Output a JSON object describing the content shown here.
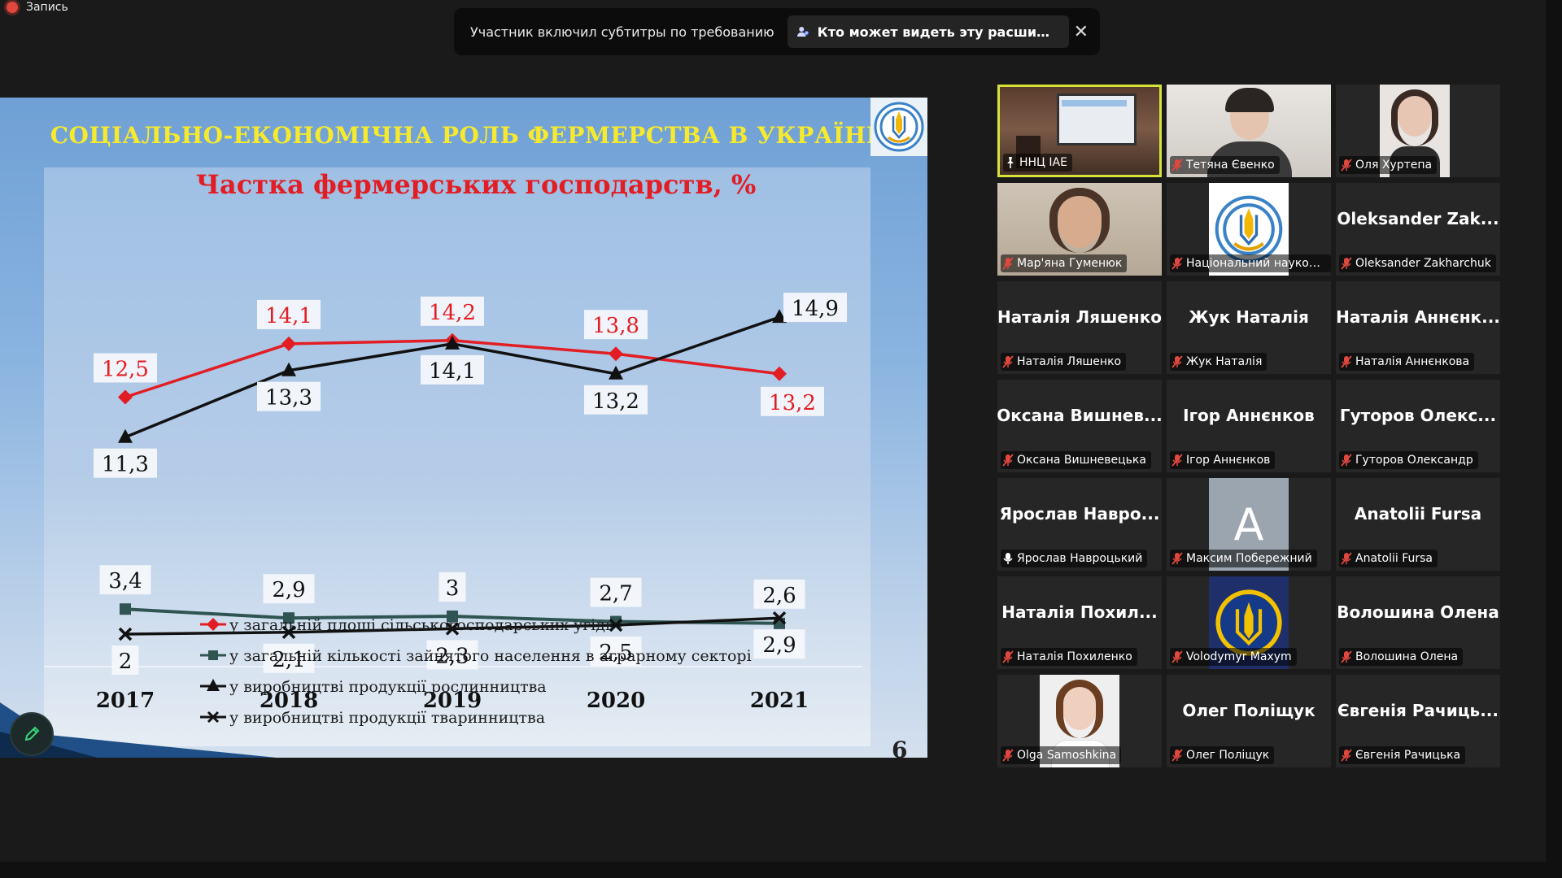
{
  "recording": {
    "label": "Запись"
  },
  "notification": {
    "text": "Участник включил субтитры по требованию",
    "prompt": "Кто может видеть эту расшифровку? За..."
  },
  "slide": {
    "title": "СОЦІАЛЬНО-ЕКОНОМІЧНА РОЛЬ ФЕРМЕРСТВА В УКРАЇНІ",
    "page_number": "6"
  },
  "chart_data": {
    "type": "line",
    "title": "Частка фермерських господарств, %",
    "x": [
      "2017",
      "2018",
      "2019",
      "2020",
      "2021"
    ],
    "series": [
      {
        "name": "у загальній площі сільськогосподарських угідь",
        "marker": "diamond",
        "color": "#e21d24",
        "values": [
          12.5,
          14.1,
          14.2,
          13.8,
          13.2
        ],
        "labels": [
          "12,5",
          "14,1",
          "14,2",
          "13,8",
          "13,2"
        ]
      },
      {
        "name": "у загальній кількості зайнятого населення в аграрному секторі",
        "marker": "square",
        "color": "#2f5452",
        "values": [
          3.4,
          2.9,
          3,
          2.7,
          2.6
        ],
        "labels": [
          "3,4",
          "2,9",
          "3",
          "2,7",
          "2,6"
        ]
      },
      {
        "name": "у виробництві продукції рослинництва",
        "marker": "triangle",
        "color": "#111111",
        "values": [
          11.3,
          13.3,
          14.1,
          13.2,
          14.9
        ],
        "labels": [
          "11,3",
          "13,3",
          "14,1",
          "13,2",
          "14,9"
        ]
      },
      {
        "name": "у виробництві продукції тваринництва",
        "marker": "cross",
        "color": "#111111",
        "values": [
          2,
          2.1,
          2.3,
          2.5,
          2.9
        ],
        "labels": [
          "2",
          "2,1",
          "2,3",
          "2,5",
          "2,9"
        ]
      }
    ],
    "ylim": [
      0,
      16
    ],
    "grid": false,
    "legend": "bottom"
  },
  "participants": [
    {
      "name": "ННЦ ІАЕ",
      "tile_label": "",
      "muted": false,
      "pinned": true,
      "video": "room",
      "active": true
    },
    {
      "name": "Тетяна Євенко",
      "tile_label": "",
      "muted": true,
      "video": "person-light"
    },
    {
      "name": "Оля Хуртепа",
      "tile_label": "",
      "muted": true,
      "video": "person-portrait"
    },
    {
      "name": "Мар'яна Гуменюк",
      "tile_label": "",
      "muted": true,
      "video": "person-warm"
    },
    {
      "name": "Національний науков...",
      "tile_label": "",
      "muted": true,
      "video": "logo-naas"
    },
    {
      "name": "Oleksander Zakharchuk",
      "tile_label": "Oleksander Zak...",
      "muted": true
    },
    {
      "name": "Наталія Ляшенко",
      "tile_label": "Наталія Ляшенко",
      "muted": true
    },
    {
      "name": "Жук Наталія",
      "tile_label": "Жук Наталія",
      "muted": true
    },
    {
      "name": "Наталія Аннєнкова",
      "tile_label": "Наталія Аннєнк...",
      "muted": true
    },
    {
      "name": "Оксана Вишневецька",
      "tile_label": "Оксана Вишнев...",
      "muted": true
    },
    {
      "name": "Ігор Аннєнков",
      "tile_label": "Ігор Аннєнков",
      "muted": true
    },
    {
      "name": "Гуторов Олександр",
      "tile_label": "Гуторов Олекс...",
      "muted": true
    },
    {
      "name": "Ярослав Навроцький",
      "tile_label": "Ярослав Навро...",
      "muted": false
    },
    {
      "name": "Максим Побережний",
      "tile_label": "",
      "muted": true,
      "video": "avatar-letter",
      "avatar_letter": "A"
    },
    {
      "name": "Anatolii Fursa",
      "tile_label": "Anatolii Fursa",
      "muted": true
    },
    {
      "name": "Наталія Похиленко",
      "tile_label": "Наталія Похил...",
      "muted": true
    },
    {
      "name": "Volodymyr Maxym",
      "tile_label": "",
      "muted": true,
      "video": "logo-trident"
    },
    {
      "name": "Волошина Олена",
      "tile_label": "Волошина Олена",
      "muted": true
    },
    {
      "name": "Olga Samoshkina",
      "tile_label": "",
      "muted": true,
      "video": "person-photo"
    },
    {
      "name": "Олег Поліщук",
      "tile_label": "Олег Поліщук",
      "muted": true
    },
    {
      "name": "Євгенія Рачицька",
      "tile_label": "Євгенія Рачиць...",
      "muted": true
    }
  ],
  "colors": {
    "accent_border": "#d6e33a",
    "mic_muted": "#e0483e",
    "title_yellow": "#f7ea2c",
    "chart_title_red": "#e21d24"
  },
  "icons": {
    "recording": "record-dot-icon",
    "captions": "people-icon",
    "close": "close-icon",
    "annotate": "pencil-icon",
    "mic": "mic-muted-icon",
    "pin": "pin-icon"
  }
}
